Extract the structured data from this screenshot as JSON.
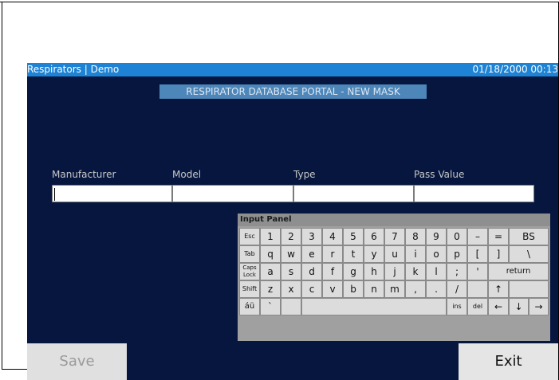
{
  "titlebar": {
    "app_title": "Respirators | Demo",
    "datetime": "01/18/2000 00:13"
  },
  "portal_title": "RESPIRATOR DATABASE PORTAL - NEW MASK",
  "form": {
    "fields": [
      {
        "label": "Manufacturer",
        "value": ""
      },
      {
        "label": "Model",
        "value": ""
      },
      {
        "label": "Type",
        "value": ""
      },
      {
        "label": "Pass Value",
        "value": ""
      }
    ]
  },
  "keyboard": {
    "title": "Input Panel",
    "rows": [
      [
        "Esc",
        "1",
        "2",
        "3",
        "4",
        "5",
        "6",
        "7",
        "8",
        "9",
        "0",
        "–",
        "=",
        "BS"
      ],
      [
        "Tab",
        "q",
        "w",
        "e",
        "r",
        "t",
        "y",
        "u",
        "i",
        "o",
        "p",
        "[",
        "]",
        "\\"
      ],
      [
        "Caps Lock",
        "a",
        "s",
        "d",
        "f",
        "g",
        "h",
        "j",
        "k",
        "l",
        ";",
        "'",
        "return"
      ],
      [
        "Shift",
        "z",
        "x",
        "c",
        "v",
        "b",
        "n",
        "m",
        ",",
        ".",
        "/",
        "",
        "↑",
        ""
      ],
      [
        "áü",
        "`",
        "",
        "space",
        "ins",
        "del",
        "←",
        "↓",
        "→"
      ]
    ]
  },
  "buttons": {
    "save": "Save",
    "exit": "Exit"
  },
  "colors": {
    "screen_bg": "#06163e",
    "titlebar": "#1e83d4",
    "portal_banner": "#4d86b9"
  }
}
